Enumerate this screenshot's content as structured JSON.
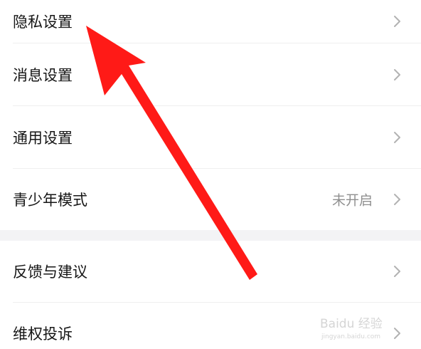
{
  "settings": {
    "items": [
      {
        "label": "隐私设置",
        "value": "",
        "icon": "chevron-right-icon"
      },
      {
        "label": "消息设置",
        "value": "",
        "icon": "chevron-right-icon"
      },
      {
        "label": "通用设置",
        "value": "",
        "icon": "chevron-right-icon"
      },
      {
        "label": "青少年模式",
        "value": "未开启",
        "icon": "chevron-right-icon"
      },
      {
        "label": "反馈与建议",
        "value": "",
        "icon": "chevron-right-icon"
      },
      {
        "label": "维权投诉",
        "value": "",
        "icon": "chevron-right-icon"
      }
    ]
  },
  "annotation": {
    "arrow_color": "#ff1a17",
    "icon": "red-arrow-icon"
  },
  "watermark": {
    "icon": "baidu-jingyan-watermark-icon",
    "text": "Baidu 经验",
    "url_text": "jingyan.baidu.com"
  },
  "colors": {
    "background": "#ffffff",
    "section_gap": "#f3f3f5",
    "text": "#161616",
    "secondary_text": "#8f8f8f",
    "chevron": "#b2b2b2"
  }
}
